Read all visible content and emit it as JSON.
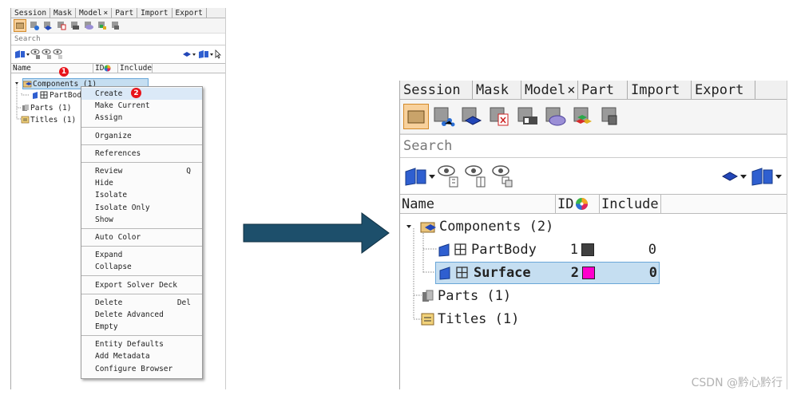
{
  "tabs": [
    {
      "label": "Session"
    },
    {
      "label": "Mask"
    },
    {
      "label": "Model",
      "close": "×"
    },
    {
      "label": "Part"
    },
    {
      "label": "Import"
    },
    {
      "label": "Export"
    }
  ],
  "search": {
    "placeholder": "Search"
  },
  "columns": {
    "name": "Name",
    "id": "ID",
    "include": "Include"
  },
  "tree": {
    "components": {
      "label": "Components (1)"
    },
    "partbody_small": {
      "label": "PartBod"
    },
    "parts": {
      "label": "Parts (1)"
    },
    "titles": {
      "label": "Titles (1)"
    }
  },
  "tree_after": {
    "components": {
      "label": "Components (2)"
    },
    "partbody": {
      "label": "PartBody",
      "id": "1",
      "include": "0",
      "color": "#404040"
    },
    "surface": {
      "label": "Surface",
      "id": "2",
      "include": "0",
      "color": "#ff00cc"
    },
    "parts": {
      "label": "Parts (1)"
    },
    "titles": {
      "label": "Titles (1)"
    }
  },
  "badges": [
    "1",
    "2"
  ],
  "context_menu": {
    "create": "Create",
    "make_current": "Make Current",
    "assign": "Assign",
    "organize": "Organize",
    "references": "References",
    "review": "Review",
    "review_shortcut": "Q",
    "hide": "Hide",
    "isolate": "Isolate",
    "isolate_only": "Isolate Only",
    "show": "Show",
    "auto_color": "Auto Color",
    "expand": "Expand",
    "collapse": "Collapse",
    "export_solver_deck": "Export Solver Deck",
    "delete": "Delete",
    "delete_shortcut": "Del",
    "delete_advanced": "Delete Advanced",
    "empty": "Empty",
    "entity_defaults": "Entity Defaults",
    "add_metadata": "Add Metadata",
    "configure_browser": "Configure Browser"
  },
  "watermark": "CSDN @黔心黔行",
  "colors": {
    "arrow": "#1d4f6b",
    "selection": "#c5def1",
    "badge": "#e8141b",
    "active_tool": "#f8d19c"
  }
}
